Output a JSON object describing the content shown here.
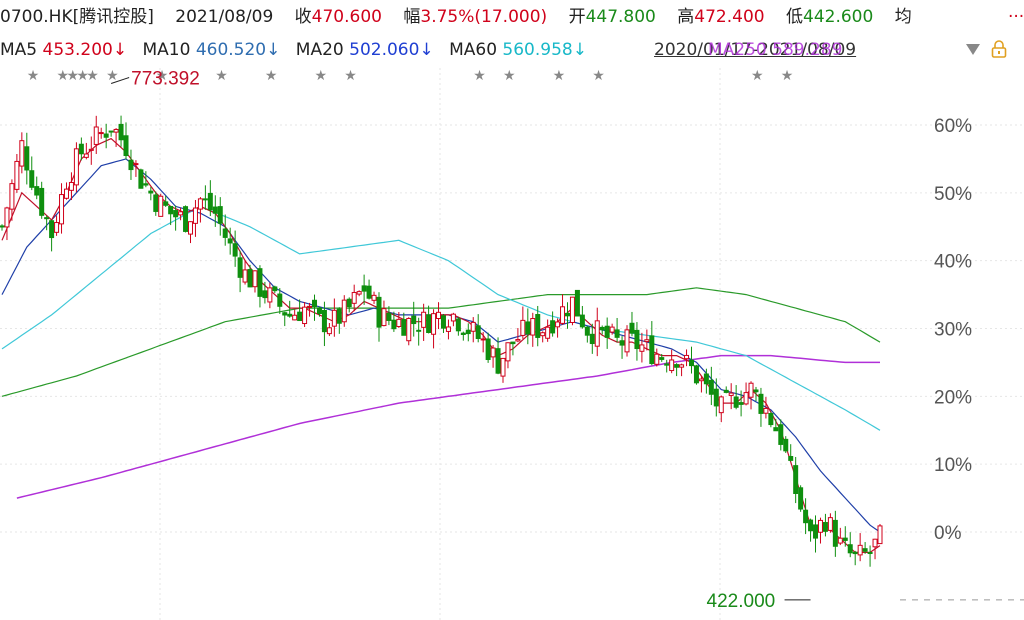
{
  "header": {
    "title": "0700.HK[腾讯控股]",
    "date": "2021/08/09",
    "close_label": "收",
    "close_value": "470.600",
    "range_label": "幅",
    "range_value": "3.75%(17.000)",
    "open_label": "开",
    "open_value": "447.800",
    "high_label": "高",
    "high_value": "472.400",
    "low_label": "低",
    "low_value": "442.600",
    "avg_label": "均",
    "more": "..."
  },
  "ma": {
    "ma5_label": "MA5",
    "ma5_value": "453.200↓",
    "ma10_label": "MA10",
    "ma10_value": "460.520↓",
    "ma20_label": "MA20",
    "ma20_value": "502.060↓",
    "ma60_label": "MA60",
    "ma60_value": "560.958↓",
    "range_text": "2020/01/17-2021/08/09",
    "range_overlay": "MA250 589.289"
  },
  "colors": {
    "up": "#d0021b",
    "down": "#0f8f0f",
    "ma5": "#c0102a",
    "ma10": "#1f3fa8",
    "ma20": "#40c8d8",
    "ma60": "#2a9a2a",
    "ma250": "#b030d8"
  },
  "chart_data": {
    "type": "candlestick",
    "y_unit": "percent",
    "ylim": [
      -10,
      68
    ],
    "yticks": [
      "60%",
      "50%",
      "40%",
      "30%",
      "20%",
      "10%",
      "0%"
    ],
    "ytick_values": [
      60,
      50,
      40,
      30,
      20,
      10,
      0
    ],
    "x_range": [
      "2020/01/17",
      "2021/08/09"
    ],
    "annotations": {
      "max_label": "773.392",
      "min_label": "422.000"
    },
    "close_path": [
      [
        0,
        45
      ],
      [
        4,
        57
      ],
      [
        7,
        50
      ],
      [
        10,
        44
      ],
      [
        13,
        52
      ],
      [
        16,
        56
      ],
      [
        19,
        58
      ],
      [
        22,
        60
      ],
      [
        25,
        57
      ],
      [
        28,
        52
      ],
      [
        31,
        49
      ],
      [
        34,
        47
      ],
      [
        37,
        46
      ],
      [
        40,
        49
      ],
      [
        43,
        47
      ],
      [
        46,
        42
      ],
      [
        49,
        38
      ],
      [
        52,
        36
      ],
      [
        55,
        34
      ],
      [
        58,
        32
      ],
      [
        61,
        33
      ],
      [
        64,
        31
      ],
      [
        67,
        31
      ],
      [
        70,
        33
      ],
      [
        73,
        36
      ],
      [
        76,
        32
      ],
      [
        79,
        31
      ],
      [
        82,
        31
      ],
      [
        85,
        31
      ],
      [
        88,
        32
      ],
      [
        91,
        32
      ],
      [
        94,
        30
      ],
      [
        97,
        28
      ],
      [
        100,
        25
      ],
      [
        103,
        28
      ],
      [
        106,
        30
      ],
      [
        109,
        30
      ],
      [
        112,
        32
      ],
      [
        115,
        34
      ],
      [
        118,
        30
      ],
      [
        121,
        29
      ],
      [
        124,
        28
      ],
      [
        127,
        28
      ],
      [
        130,
        27
      ],
      [
        133,
        26
      ],
      [
        136,
        26
      ],
      [
        139,
        24
      ],
      [
        142,
        21
      ],
      [
        145,
        18
      ],
      [
        148,
        20
      ],
      [
        151,
        21
      ],
      [
        154,
        18
      ],
      [
        157,
        14
      ],
      [
        160,
        6
      ],
      [
        163,
        -1
      ],
      [
        166,
        2
      ],
      [
        169,
        -2
      ],
      [
        172,
        -4
      ],
      [
        175,
        -3
      ],
      [
        177,
        -1
      ]
    ],
    "ma5": [
      [
        0,
        43
      ],
      [
        4,
        50
      ],
      [
        7,
        48
      ],
      [
        10,
        46
      ],
      [
        13,
        50
      ],
      [
        16,
        55
      ],
      [
        19,
        57
      ],
      [
        22,
        58
      ],
      [
        25,
        56
      ],
      [
        28,
        53
      ],
      [
        31,
        50
      ],
      [
        34,
        48
      ],
      [
        37,
        47
      ],
      [
        40,
        48
      ],
      [
        43,
        47
      ],
      [
        46,
        44
      ],
      [
        49,
        40
      ],
      [
        52,
        37
      ],
      [
        55,
        35
      ],
      [
        58,
        33
      ],
      [
        61,
        33
      ],
      [
        64,
        32
      ],
      [
        67,
        31
      ],
      [
        70,
        32
      ],
      [
        73,
        34
      ],
      [
        76,
        33
      ],
      [
        79,
        32
      ],
      [
        82,
        31
      ],
      [
        85,
        31
      ],
      [
        88,
        32
      ],
      [
        91,
        32
      ],
      [
        94,
        31
      ],
      [
        97,
        29
      ],
      [
        100,
        26
      ],
      [
        103,
        27
      ],
      [
        106,
        29
      ],
      [
        109,
        30
      ],
      [
        112,
        31
      ],
      [
        115,
        33
      ],
      [
        118,
        31
      ],
      [
        121,
        29
      ],
      [
        124,
        28
      ],
      [
        127,
        28
      ],
      [
        130,
        27
      ],
      [
        133,
        26
      ],
      [
        136,
        26
      ],
      [
        139,
        25
      ],
      [
        142,
        22
      ],
      [
        145,
        19
      ],
      [
        148,
        19
      ],
      [
        151,
        21
      ],
      [
        154,
        19
      ],
      [
        157,
        15
      ],
      [
        160,
        8
      ],
      [
        163,
        1
      ],
      [
        166,
        1
      ],
      [
        169,
        -1
      ],
      [
        172,
        -3
      ],
      [
        175,
        -3
      ],
      [
        177,
        -2
      ]
    ],
    "ma10": [
      [
        0,
        35
      ],
      [
        5,
        42
      ],
      [
        10,
        46
      ],
      [
        15,
        50
      ],
      [
        20,
        54
      ],
      [
        25,
        55
      ],
      [
        30,
        52
      ],
      [
        35,
        48
      ],
      [
        40,
        47
      ],
      [
        45,
        45
      ],
      [
        50,
        40
      ],
      [
        55,
        36
      ],
      [
        60,
        34
      ],
      [
        65,
        33
      ],
      [
        70,
        32
      ],
      [
        75,
        33
      ],
      [
        80,
        32
      ],
      [
        85,
        32
      ],
      [
        90,
        32
      ],
      [
        95,
        31
      ],
      [
        100,
        28
      ],
      [
        105,
        29
      ],
      [
        110,
        30
      ],
      [
        115,
        31
      ],
      [
        120,
        30
      ],
      [
        125,
        29
      ],
      [
        130,
        28
      ],
      [
        135,
        27
      ],
      [
        140,
        25
      ],
      [
        145,
        21
      ],
      [
        150,
        20
      ],
      [
        155,
        18
      ],
      [
        160,
        14
      ],
      [
        165,
        9
      ],
      [
        170,
        5
      ],
      [
        175,
        1
      ],
      [
        177,
        0
      ]
    ],
    "ma20": [
      [
        0,
        27
      ],
      [
        10,
        32
      ],
      [
        20,
        38
      ],
      [
        30,
        44
      ],
      [
        40,
        48
      ],
      [
        50,
        45
      ],
      [
        60,
        41
      ],
      [
        70,
        42
      ],
      [
        80,
        43
      ],
      [
        90,
        40
      ],
      [
        100,
        35
      ],
      [
        110,
        32
      ],
      [
        120,
        30
      ],
      [
        130,
        29
      ],
      [
        140,
        28
      ],
      [
        150,
        26
      ],
      [
        160,
        22
      ],
      [
        170,
        18
      ],
      [
        177,
        15
      ]
    ],
    "ma60": [
      [
        0,
        20
      ],
      [
        15,
        23
      ],
      [
        30,
        27
      ],
      [
        45,
        31
      ],
      [
        60,
        33
      ],
      [
        75,
        33
      ],
      [
        90,
        33
      ],
      [
        100,
        34
      ],
      [
        110,
        35
      ],
      [
        120,
        35
      ],
      [
        130,
        35
      ],
      [
        140,
        36
      ],
      [
        150,
        35
      ],
      [
        160,
        33
      ],
      [
        170,
        31
      ],
      [
        177,
        28
      ]
    ],
    "ma250": [
      [
        3,
        5
      ],
      [
        20,
        8
      ],
      [
        40,
        12
      ],
      [
        60,
        16
      ],
      [
        80,
        19
      ],
      [
        100,
        21
      ],
      [
        120,
        23
      ],
      [
        135,
        25
      ],
      [
        145,
        26
      ],
      [
        155,
        26
      ],
      [
        170,
        25
      ],
      [
        177,
        25
      ]
    ],
    "star_markers": [
      3,
      6,
      7,
      8,
      9,
      11,
      16,
      22,
      27,
      32,
      35,
      48,
      51,
      56,
      60,
      76,
      79
    ]
  }
}
